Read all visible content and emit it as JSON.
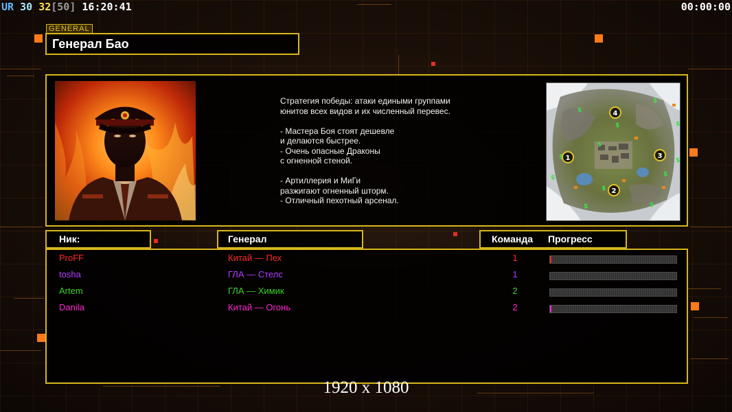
{
  "hud": {
    "ur_label": "UR",
    "fps": "30",
    "ping": "32",
    "ping_max": "[50]",
    "clock": "16:20:41",
    "timer": "00:00:00"
  },
  "general": {
    "tag": "GENERAL",
    "name": "Генерал Бао"
  },
  "description": {
    "lines": [
      "Стратегия победы: атаки едиными группами",
      "юнитов всех видов и их численный перевес.",
      "",
      "- Мастера Боя стоят дешевле",
      "и делаются быстрее.",
      "- Очень опасные Драконы",
      "с огненной стеной.",
      "",
      "- Артиллерия и МиГи",
      "разжигают огненный шторм.",
      "- Отличный пехотный арсенал."
    ]
  },
  "minimap": {
    "start_positions": [
      "1",
      "2",
      "3",
      "4"
    ]
  },
  "columns": {
    "nick": "Ник:",
    "general": "Генерал",
    "team": "Команда",
    "progress": "Прогресс"
  },
  "players": [
    {
      "nick": "ProFF",
      "general": "Китай — Пех",
      "team": "1",
      "color": "#ff2a2a",
      "progress": 0.01
    },
    {
      "nick": "tosha",
      "general": "ГЛА — Стелс",
      "team": "1",
      "color": "#b23cff",
      "progress": 0.0
    },
    {
      "nick": "Artem",
      "general": "ГЛА — Химик",
      "team": "2",
      "color": "#3ed12a",
      "progress": 0.0
    },
    {
      "nick": "Danila",
      "general": "Китай — Огонь",
      "team": "2",
      "color": "#ff2ad0",
      "progress": 0.01
    }
  ],
  "resolution": "1920 x 1080",
  "colors": {
    "frame": "#d8b71c",
    "accent_orange": "#ff7a1a"
  }
}
